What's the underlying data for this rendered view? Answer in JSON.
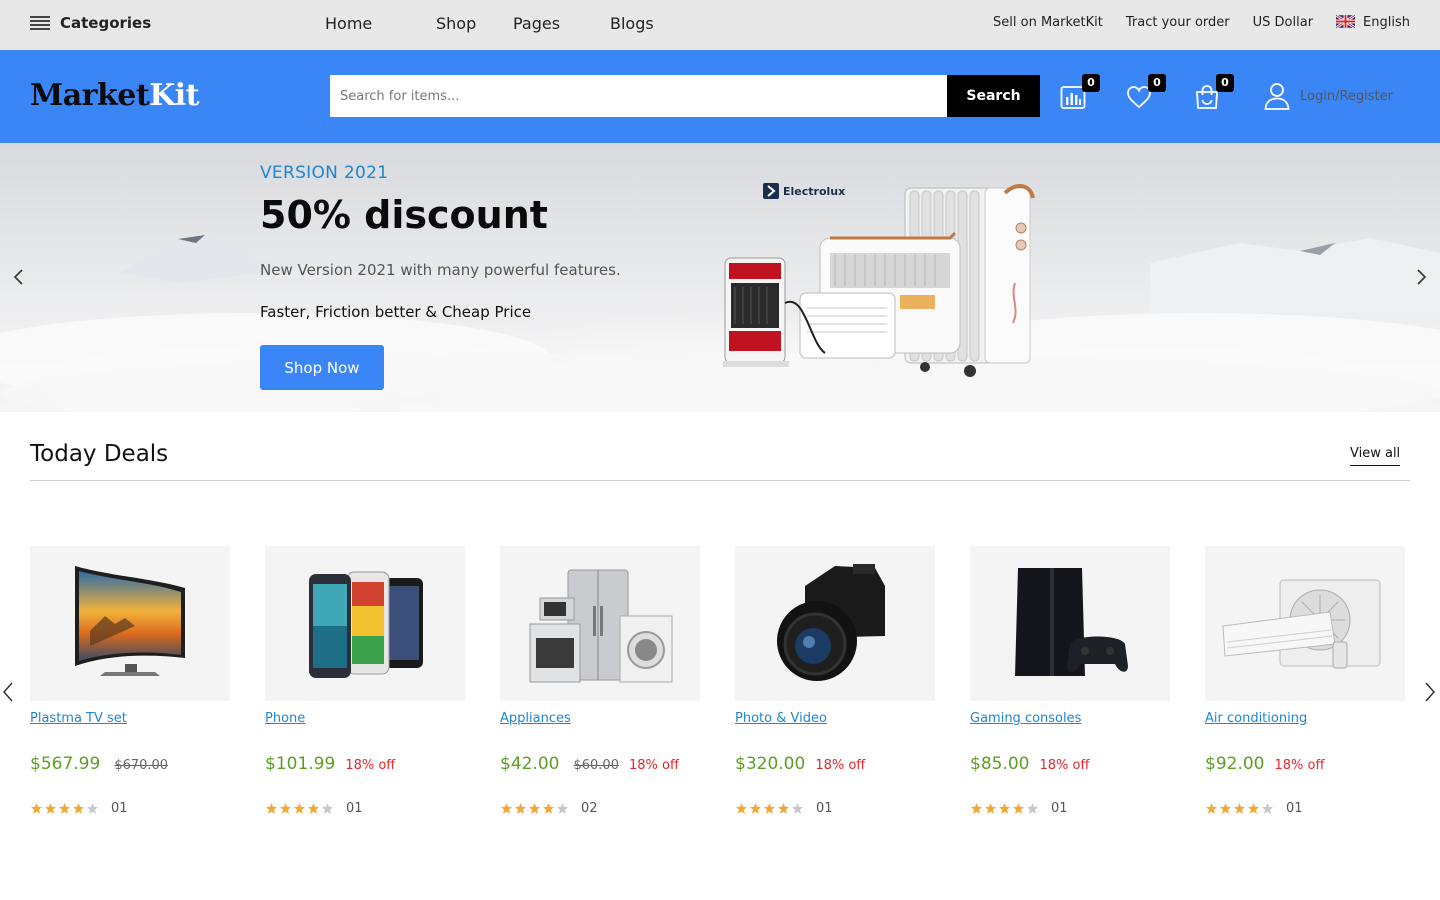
{
  "topbar": {
    "categories_label": "Categories",
    "nav": [
      "Home",
      "Shop",
      "Pages",
      "Blogs"
    ],
    "sell": "Sell on MarketKit",
    "track": "Tract your order",
    "currency": "US Dollar",
    "language": "English"
  },
  "header": {
    "logo_part1": "Market",
    "logo_part2": "Kit",
    "search_placeholder": "Search for items...",
    "search_button": "Search",
    "compare_count": "0",
    "wishlist_count": "0",
    "cart_count": "0",
    "login_label": "Login/Register",
    "accent_color": "#3b86f7"
  },
  "hero": {
    "eyebrow": "VERSION 2021",
    "title": "50% discount",
    "subtitle": "New Version 2021 with many powerful features.",
    "tagline": "Faster, Friction better & Cheap Price",
    "button": "Shop Now",
    "brand": "Electrolux"
  },
  "deals": {
    "title": "Today Deals",
    "view_all": "View all",
    "items": [
      {
        "name": "Plastma TV set",
        "price": "$567.99",
        "old_price": "$670.00",
        "discount": "",
        "rating": 4,
        "reviews": "01",
        "icon": "tv-image"
      },
      {
        "name": "Phone",
        "price": "$101.99",
        "old_price": "",
        "discount": "18% off",
        "rating": 4,
        "reviews": "01",
        "icon": "phones-image"
      },
      {
        "name": "Appliances",
        "price": "$42.00",
        "old_price": "$60.00",
        "discount": "18% off",
        "rating": 4,
        "reviews": "02",
        "icon": "appliances-image"
      },
      {
        "name": "Photo & Video",
        "price": "$320.00",
        "old_price": "",
        "discount": "18% off",
        "rating": 4,
        "reviews": "01",
        "icon": "camera-image"
      },
      {
        "name": "Gaming consoles",
        "price": "$85.00",
        "old_price": "",
        "discount": "18% off",
        "rating": 4,
        "reviews": "01",
        "icon": "console-image"
      },
      {
        "name": "Air conditioning",
        "price": "$92.00",
        "old_price": "",
        "discount": "18% off",
        "rating": 4,
        "reviews": "01",
        "icon": "air-conditioner-image"
      }
    ]
  },
  "colors": {
    "price_green": "#5e9e22",
    "discount_red": "#e5262b",
    "link_blue": "#1f86d2",
    "star_gold": "#f0a93b"
  }
}
